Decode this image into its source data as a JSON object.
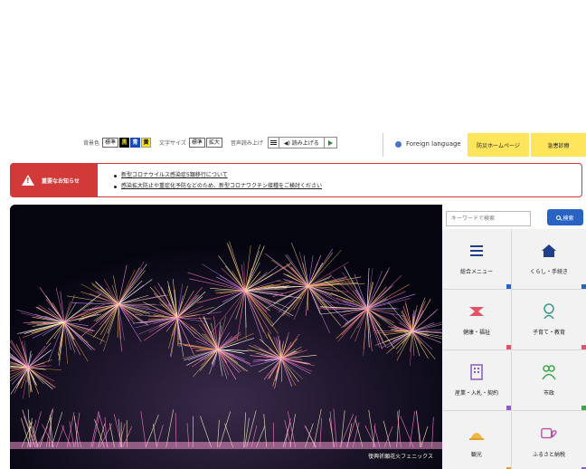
{
  "utility_bar": {
    "bg_color_label": "背景色",
    "bg_standard": "標準",
    "bg_black": "黒",
    "bg_blue": "青",
    "bg_yellow": "黄",
    "font_size_label": "文字サイズ",
    "font_standard": "標準",
    "font_enlarge": "拡大",
    "read_aloud_label": "音声読み上げ",
    "read_aloud_button": "◀) 読み上げる",
    "foreign_language": "Foreign language",
    "disaster_homepage": "防災ホームページ",
    "emergency_info": "急患診療"
  },
  "notice": {
    "heading": "重要なお知らせ",
    "items": [
      "新型コロナウイルス感染症5類移行について",
      "感染拡大防止や重症化予防などのため、新型コロナワクチン接種をご検討ください"
    ]
  },
  "hero": {
    "caption": "復興祈願花火フェニックス"
  },
  "search": {
    "placeholder": "キーワードで検索",
    "button_label": "検索"
  },
  "tiles": [
    {
      "label": "総合メニュー",
      "icon": "menu-icon",
      "accent": "#2a63c2"
    },
    {
      "label": "くらし・手続き",
      "icon": "house-icon",
      "accent": "#2a63c2"
    },
    {
      "label": "健康・福祉",
      "icon": "health-icon",
      "accent": "#e0556b"
    },
    {
      "label": "子育て・教育",
      "icon": "child-icon",
      "accent": "#e0556b"
    },
    {
      "label": "産業・入札・契約",
      "icon": "building-icon",
      "accent": "#8a5bc4"
    },
    {
      "label": "市政",
      "icon": "city-icon",
      "accent": "#3aa84a"
    },
    {
      "label": "観光",
      "icon": "tourism-icon",
      "accent": "#e0a030"
    },
    {
      "label": "ふるさと納税",
      "icon": "furusato-icon",
      "accent": "#8a5bc4"
    }
  ],
  "colors": {
    "notice_red": "#d23a3a",
    "accent_blue": "#2a63c2",
    "banner_yellow": "#ffe55c"
  }
}
